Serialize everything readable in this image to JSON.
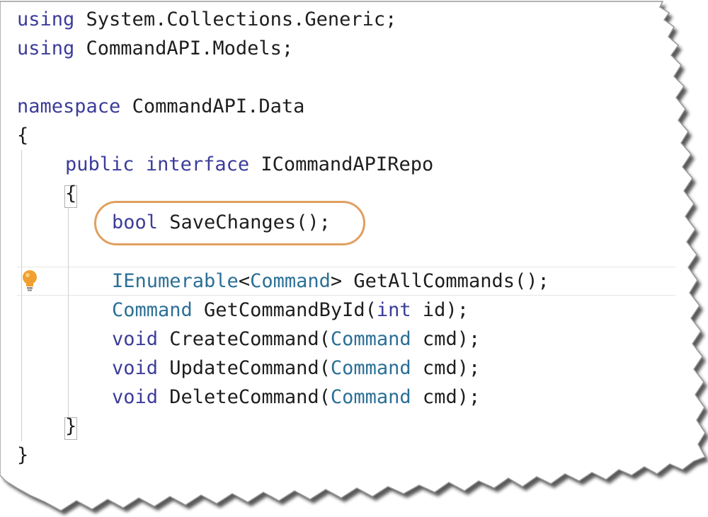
{
  "colors": {
    "keyword": "#3c3c9a",
    "type": "#2b6f96",
    "text": "#1e1e1e",
    "highlight_oval": "#e0a060",
    "lightbulb": "#f0a030"
  },
  "icons": {
    "lightbulb": "lightbulb-icon"
  },
  "code_lines": [
    {
      "tokens": [
        {
          "t": "using",
          "k": "keyword"
        },
        {
          "t": " System.Collections.Generic;",
          "k": "plain"
        }
      ]
    },
    {
      "tokens": [
        {
          "t": "using",
          "k": "keyword"
        },
        {
          "t": " CommandAPI.Models;",
          "k": "plain"
        }
      ]
    },
    {
      "tokens": []
    },
    {
      "tokens": [
        {
          "t": "namespace",
          "k": "keyword"
        },
        {
          "t": " CommandAPI.Data",
          "k": "plain"
        }
      ]
    },
    {
      "tokens": [
        {
          "t": "{",
          "k": "punct"
        }
      ]
    },
    {
      "tokens": [
        {
          "t": "public",
          "k": "keyword"
        },
        {
          "t": " ",
          "k": "plain"
        },
        {
          "t": "interface",
          "k": "keyword"
        },
        {
          "t": " ICommandAPIRepo",
          "k": "plain"
        }
      ]
    },
    {
      "tokens": [
        {
          "t": "{",
          "k": "punct"
        }
      ]
    },
    {
      "tokens": [
        {
          "t": "bool",
          "k": "keyword"
        },
        {
          "t": " SaveChanges();",
          "k": "plain"
        }
      ]
    },
    {
      "tokens": []
    },
    {
      "tokens": [
        {
          "t": "IEnumerable",
          "k": "type"
        },
        {
          "t": "<",
          "k": "plain"
        },
        {
          "t": "Command",
          "k": "type"
        },
        {
          "t": "> GetAllCommands();",
          "k": "plain"
        }
      ]
    },
    {
      "tokens": [
        {
          "t": "Command",
          "k": "type"
        },
        {
          "t": " GetCommandById(",
          "k": "plain"
        },
        {
          "t": "int",
          "k": "keyword"
        },
        {
          "t": " id);",
          "k": "plain"
        }
      ]
    },
    {
      "tokens": [
        {
          "t": "void",
          "k": "keyword"
        },
        {
          "t": " CreateCommand(",
          "k": "plain"
        },
        {
          "t": "Command",
          "k": "type"
        },
        {
          "t": " cmd);",
          "k": "plain"
        }
      ]
    },
    {
      "tokens": [
        {
          "t": "void",
          "k": "keyword"
        },
        {
          "t": " UpdateCommand(",
          "k": "plain"
        },
        {
          "t": "Command",
          "k": "type"
        },
        {
          "t": " cmd);",
          "k": "plain"
        }
      ]
    },
    {
      "tokens": [
        {
          "t": "void",
          "k": "keyword"
        },
        {
          "t": " DeleteCommand(",
          "k": "plain"
        },
        {
          "t": "Command",
          "k": "type"
        },
        {
          "t": " cmd);",
          "k": "plain"
        }
      ]
    },
    {
      "tokens": [
        {
          "t": "}",
          "k": "punct"
        }
      ]
    },
    {
      "tokens": [
        {
          "t": "}",
          "k": "punct"
        }
      ]
    }
  ]
}
